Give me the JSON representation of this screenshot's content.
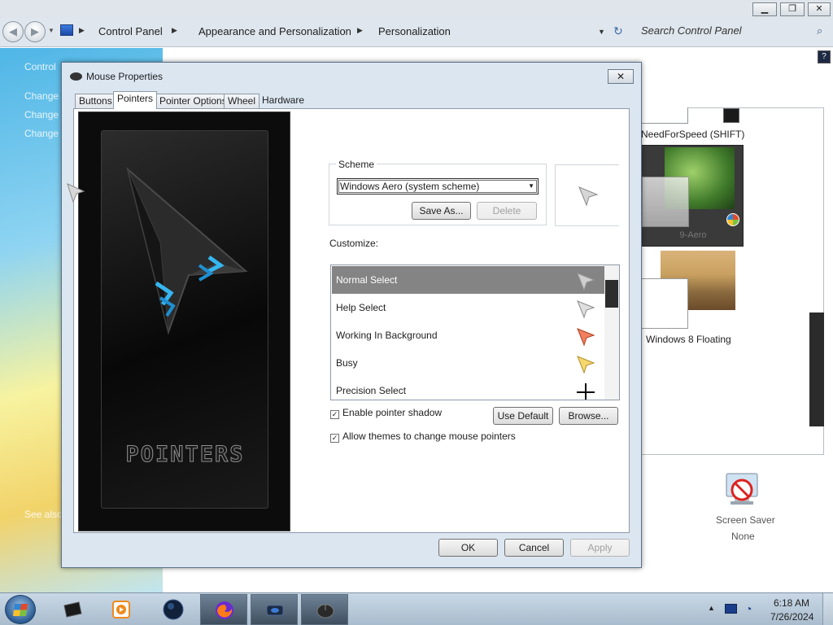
{
  "explorer": {
    "breadcrumbs": [
      "Control Panel",
      "Appearance and Personalization",
      "Personalization"
    ],
    "search_placeholder": "Search Control Panel",
    "sidebar_items": [
      "Control",
      "Change",
      "Change",
      "Change"
    ],
    "see_also": "See also"
  },
  "themes": {
    "need_for_speed": "NeedForSpeed (SHIFT)",
    "aero": "9-Aero",
    "windows8_floating": "Windows 8 Floating"
  },
  "screen_saver": {
    "label": "Screen Saver",
    "value": "None"
  },
  "dialog": {
    "title": "Mouse Properties",
    "close": "✕",
    "tabs": [
      {
        "label": "Buttons"
      },
      {
        "label": "Pointers"
      },
      {
        "label": "Pointer Options"
      },
      {
        "label": "Wheel"
      },
      {
        "label": "Hardware"
      }
    ],
    "active_tab": "Pointers",
    "preview_word": "POINTERS",
    "scheme": {
      "group_label": "Scheme",
      "selected": "Windows Aero (system scheme)",
      "save_as": "Save As...",
      "delete": "Delete"
    },
    "customize_label": "Customize:",
    "cursors": [
      {
        "name": "Normal Select",
        "icon": "arrow-gray-icon",
        "selected": true
      },
      {
        "name": "Help Select",
        "icon": "arrow-help-icon"
      },
      {
        "name": "Working In Background",
        "icon": "arrow-red-icon"
      },
      {
        "name": "Busy",
        "icon": "arrow-yellow-icon"
      },
      {
        "name": "Precision Select",
        "icon": "crosshair-icon"
      }
    ],
    "enable_shadow": {
      "label": "Enable pointer shadow",
      "checked": true
    },
    "allow_themes": {
      "label": "Allow themes to change mouse pointers",
      "checked": true
    },
    "use_default": "Use Default",
    "browse": "Browse...",
    "ok": "OK",
    "cancel": "Cancel",
    "apply": "Apply"
  },
  "taskbar": {
    "time": "6:18 AM",
    "date": "7/26/2024",
    "items": [
      "black-box-icon",
      "media-player-icon",
      "dark-orb-icon",
      "firefox-icon",
      "mouse-app-icon",
      "mouse-properties-icon"
    ]
  },
  "colors": {
    "selection": "#848484",
    "dialog_frame": "#dbe6f1",
    "taskbar": "#b9cad9"
  }
}
